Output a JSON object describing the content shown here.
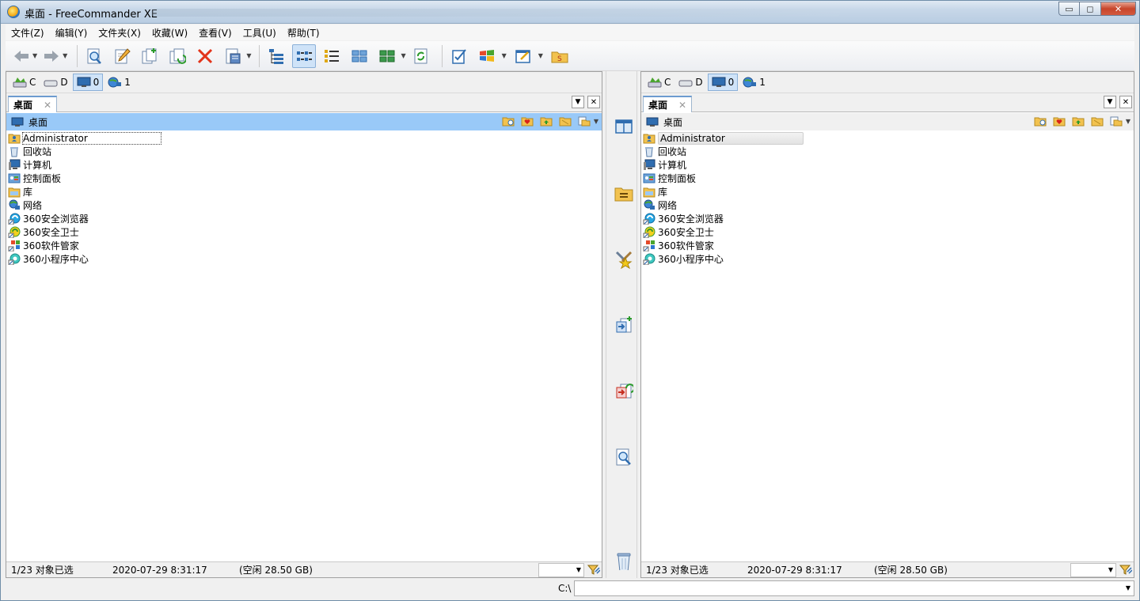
{
  "window": {
    "title": "桌面 - FreeCommander XE",
    "minimize": "▭",
    "maximize": "◻",
    "close": "✕"
  },
  "menu": [
    "文件(Z)",
    "编辑(Y)",
    "文件夹(X)",
    "收藏(W)",
    "查看(V)",
    "工具(U)",
    "帮助(T)"
  ],
  "drives": [
    {
      "label": "C",
      "icon": "drive-c-icon"
    },
    {
      "label": "D",
      "icon": "drive-d-icon"
    },
    {
      "label": "0",
      "icon": "desktop-icon",
      "active": true
    },
    {
      "label": "1",
      "icon": "network-icon"
    }
  ],
  "left": {
    "tab": {
      "label": "桌面",
      "close": "✕"
    },
    "path": "桌面",
    "files": [
      "Administrator",
      "回收站",
      "计算机",
      "控制面板",
      "库",
      "网络",
      "360安全浏览器",
      "360安全卫士",
      "360软件管家",
      "360小程序中心"
    ],
    "status": {
      "selected": "1/23 对象已选",
      "date": "2020-07-29 8:31:17",
      "free": "(空闲 28.50 GB)"
    }
  },
  "right": {
    "tab": {
      "label": "桌面",
      "close": "✕"
    },
    "path": "桌面",
    "files": [
      "Administrator",
      "回收站",
      "计算机",
      "控制面板",
      "库",
      "网络",
      "360安全浏览器",
      "360安全卫士",
      "360软件管家",
      "360小程序中心"
    ],
    "status": {
      "selected": "1/23 对象已选",
      "date": "2020-07-29 8:31:17",
      "free": "(空闲 28.50 GB)"
    }
  },
  "tabctrl": {
    "dropdown": "▼",
    "close": "✕"
  },
  "cmdline": {
    "label": "C:\\",
    "value": ""
  }
}
